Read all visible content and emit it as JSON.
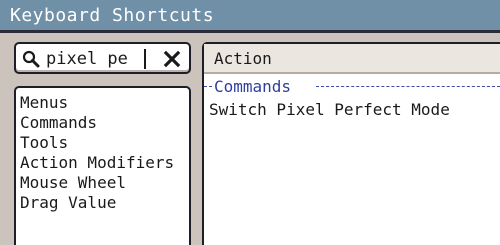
{
  "window": {
    "title": "Keyboard Shortcuts"
  },
  "search": {
    "value": "pixel pe",
    "placeholder": ""
  },
  "categories": [
    {
      "label": "Menus"
    },
    {
      "label": "Commands"
    },
    {
      "label": "Tools"
    },
    {
      "label": "Action Modifiers"
    },
    {
      "label": "Mouse Wheel"
    },
    {
      "label": "Drag Value"
    }
  ],
  "table": {
    "column_header": "Action",
    "group": "Commands",
    "rows": [
      {
        "label": "Switch Pixel Perfect Mode"
      }
    ]
  },
  "icons": {
    "search": "magnifier-icon",
    "clear": "close-icon"
  },
  "colors": {
    "titlebar": "#6f90a6",
    "background": "#ccc4bc",
    "group_text": "#2e3e9e"
  }
}
